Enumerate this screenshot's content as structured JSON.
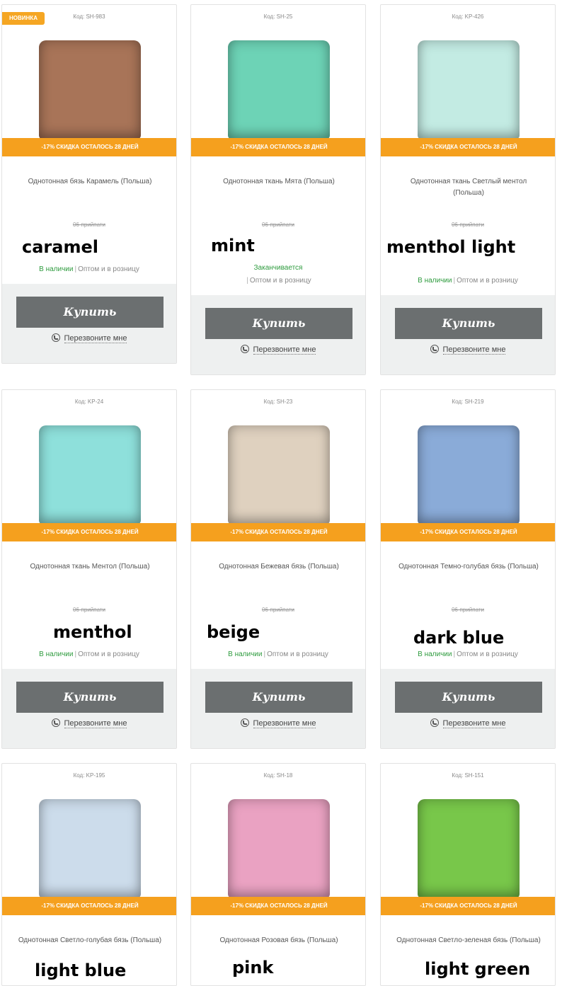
{
  "common": {
    "discount_text": "-17% СКИДКА  ОСТАЛОСЬ 28 ДНЕЙ",
    "price_old": "06-прийпати",
    "buy_label": "Купить",
    "callback_label": "Перезвоните мне",
    "wholesale_label": "Оптом и в розницу",
    "in_stock_label": "В наличии",
    "ending_label": "Заканчивается",
    "new_badge": "НОВИНКА"
  },
  "products": [
    {
      "code": "Код: SH-983",
      "name": "Однотонная бязь Карамель (Польша)",
      "color_label": "caramel",
      "swatch": "#a87458",
      "availability": "В наличии",
      "new": true
    },
    {
      "code": "Код: SH-25",
      "name": "Однотонная ткань Мята (Польша)",
      "color_label": "mint",
      "swatch": "#6dd3b6",
      "availability": "Заканчивается",
      "new": false
    },
    {
      "code": "Код: KP-426",
      "name": "Однотонная ткань Светлый ментол (Польша)",
      "color_label": "menthol light",
      "swatch": "#c3ebe3",
      "availability": "В наличии",
      "new": false
    },
    {
      "code": "Код: KP-24",
      "name": "Однотонная ткань Ментол (Польша)",
      "color_label": "menthol",
      "swatch": "#8ee0db",
      "availability": "В наличии",
      "new": false
    },
    {
      "code": "Код: SH-23",
      "name": "Однотонная Бежевая бязь (Польша)",
      "color_label": "beige",
      "swatch": "#dfd1bf",
      "availability": "В наличии",
      "new": false
    },
    {
      "code": "Код: SH-219",
      "name": "Однотонная Темно-голубая бязь (Польша)",
      "color_label": "dark blue",
      "swatch": "#8aabd8",
      "availability": "В наличии",
      "new": false
    },
    {
      "code": "Код: KP-195",
      "name": "Однотонная Светло-голубая бязь (Польша)",
      "color_label": "light blue",
      "swatch": "#ccdceb",
      "availability": "",
      "new": false
    },
    {
      "code": "Код: SH-18",
      "name": "Однотонная Розовая бязь (Польша)",
      "color_label": "pink",
      "swatch": "#eaa2c2",
      "availability": "",
      "new": false
    },
    {
      "code": "Код: SH-151",
      "name": "Однотонная Светло-зеленая бязь (Польша)",
      "color_label": "light green",
      "swatch": "#78c74a",
      "availability": "",
      "new": false
    }
  ]
}
